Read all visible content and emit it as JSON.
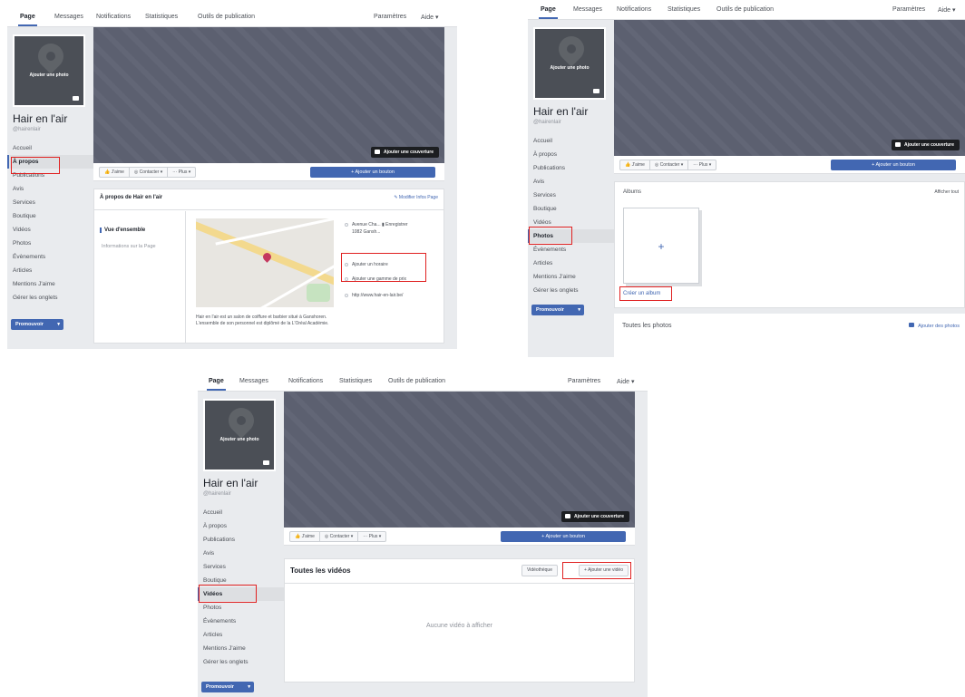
{
  "top_tabs": [
    "Page",
    "Messages",
    "Notifications",
    "Statistiques",
    "Outils de publication"
  ],
  "right_tabs": {
    "settings": "Paramètres",
    "help": "Aide ▾"
  },
  "page": {
    "name": "Hair en l'air",
    "handle": "@hairenlair",
    "add_photo": "Ajouter une photo",
    "add_cover": "Ajouter une couverture"
  },
  "nav_items": [
    "Accueil",
    "À propos",
    "Publications",
    "Avis",
    "Services",
    "Boutique",
    "Vidéos",
    "Photos",
    "Évènements",
    "Articles",
    "Mentions J'aime",
    "Gérer les onglets"
  ],
  "promote": "Promouvoir",
  "actions": {
    "like": "👍 J'aime",
    "contact": "◎ Contacter ▾",
    "more": "··· Plus ▾",
    "add_button": "+ Ajouter un bouton"
  },
  "about": {
    "title": "À propos de Hair en l'air",
    "edit": "✎ Modifier Infos Page",
    "overview": "Vue d'ensemble",
    "page_info": "Informations sur la Page",
    "address": "Avenue Cha...   ▮ Enregistrer",
    "address2": "1082 Gansh...",
    "add_hours": "Ajouter un horaire",
    "add_price": "Ajouter une gamme de prix",
    "website": "http://www.hair-en-lair.be/",
    "description": "Hair en l'air est un salon de coiffure et barbier situé à Ganshoren. L'ensemble de son personnel est diplômé de la L'Oréal Académie."
  },
  "photos": {
    "albums": "Albums",
    "see_all": "Afficher tout",
    "plus": "+",
    "create_album": "Créer un album",
    "all_photos": "Toutes les photos",
    "add_photos": "Ajouter des photos"
  },
  "videos": {
    "title": "Toutes les vidéos",
    "library": "Vidéothèque",
    "add_video": "+ Ajouter une vidéo",
    "empty": "Aucune vidéo à afficher"
  },
  "colors": {
    "accent": "#4267b2",
    "highlight": "#e02020",
    "cover": "#5c6070"
  }
}
